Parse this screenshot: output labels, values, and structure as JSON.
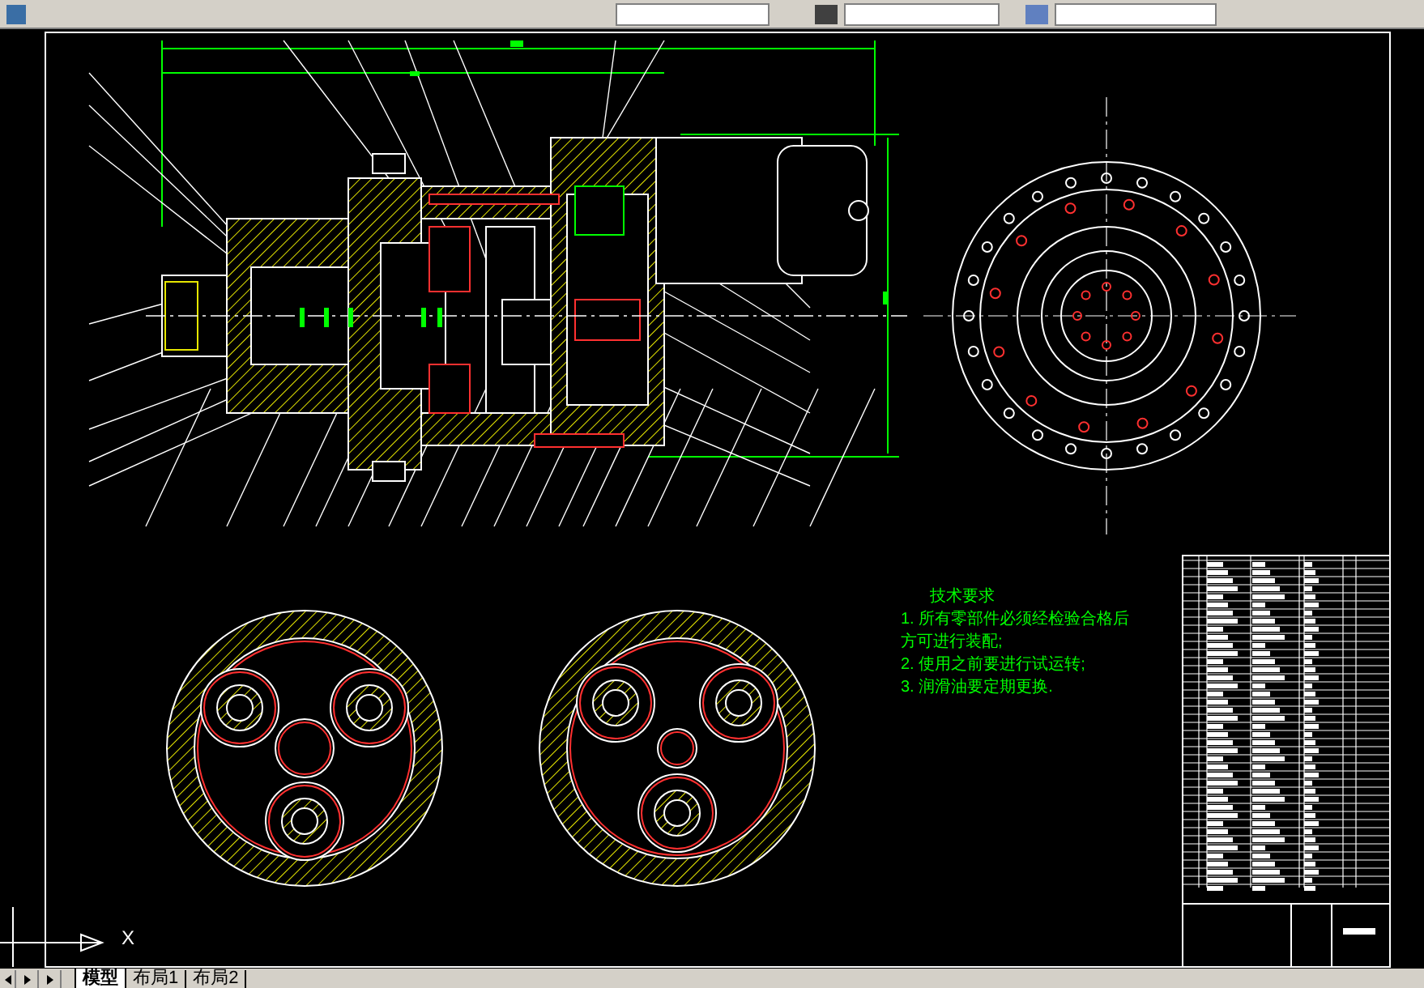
{
  "drawing": {
    "tech_requirements": {
      "title": "技术要求",
      "lines": [
        "1. 所有零部件必须经检验合格后",
        "方可进行装配;",
        "2. 使用之前要进行试运转;",
        "3. 润滑油要定期更换."
      ]
    },
    "ucs_axis_label": "X"
  },
  "tabs": [
    {
      "label": "模型",
      "selected": true
    },
    {
      "label": "布局1",
      "selected": false
    },
    {
      "label": "布局2",
      "selected": false
    }
  ]
}
